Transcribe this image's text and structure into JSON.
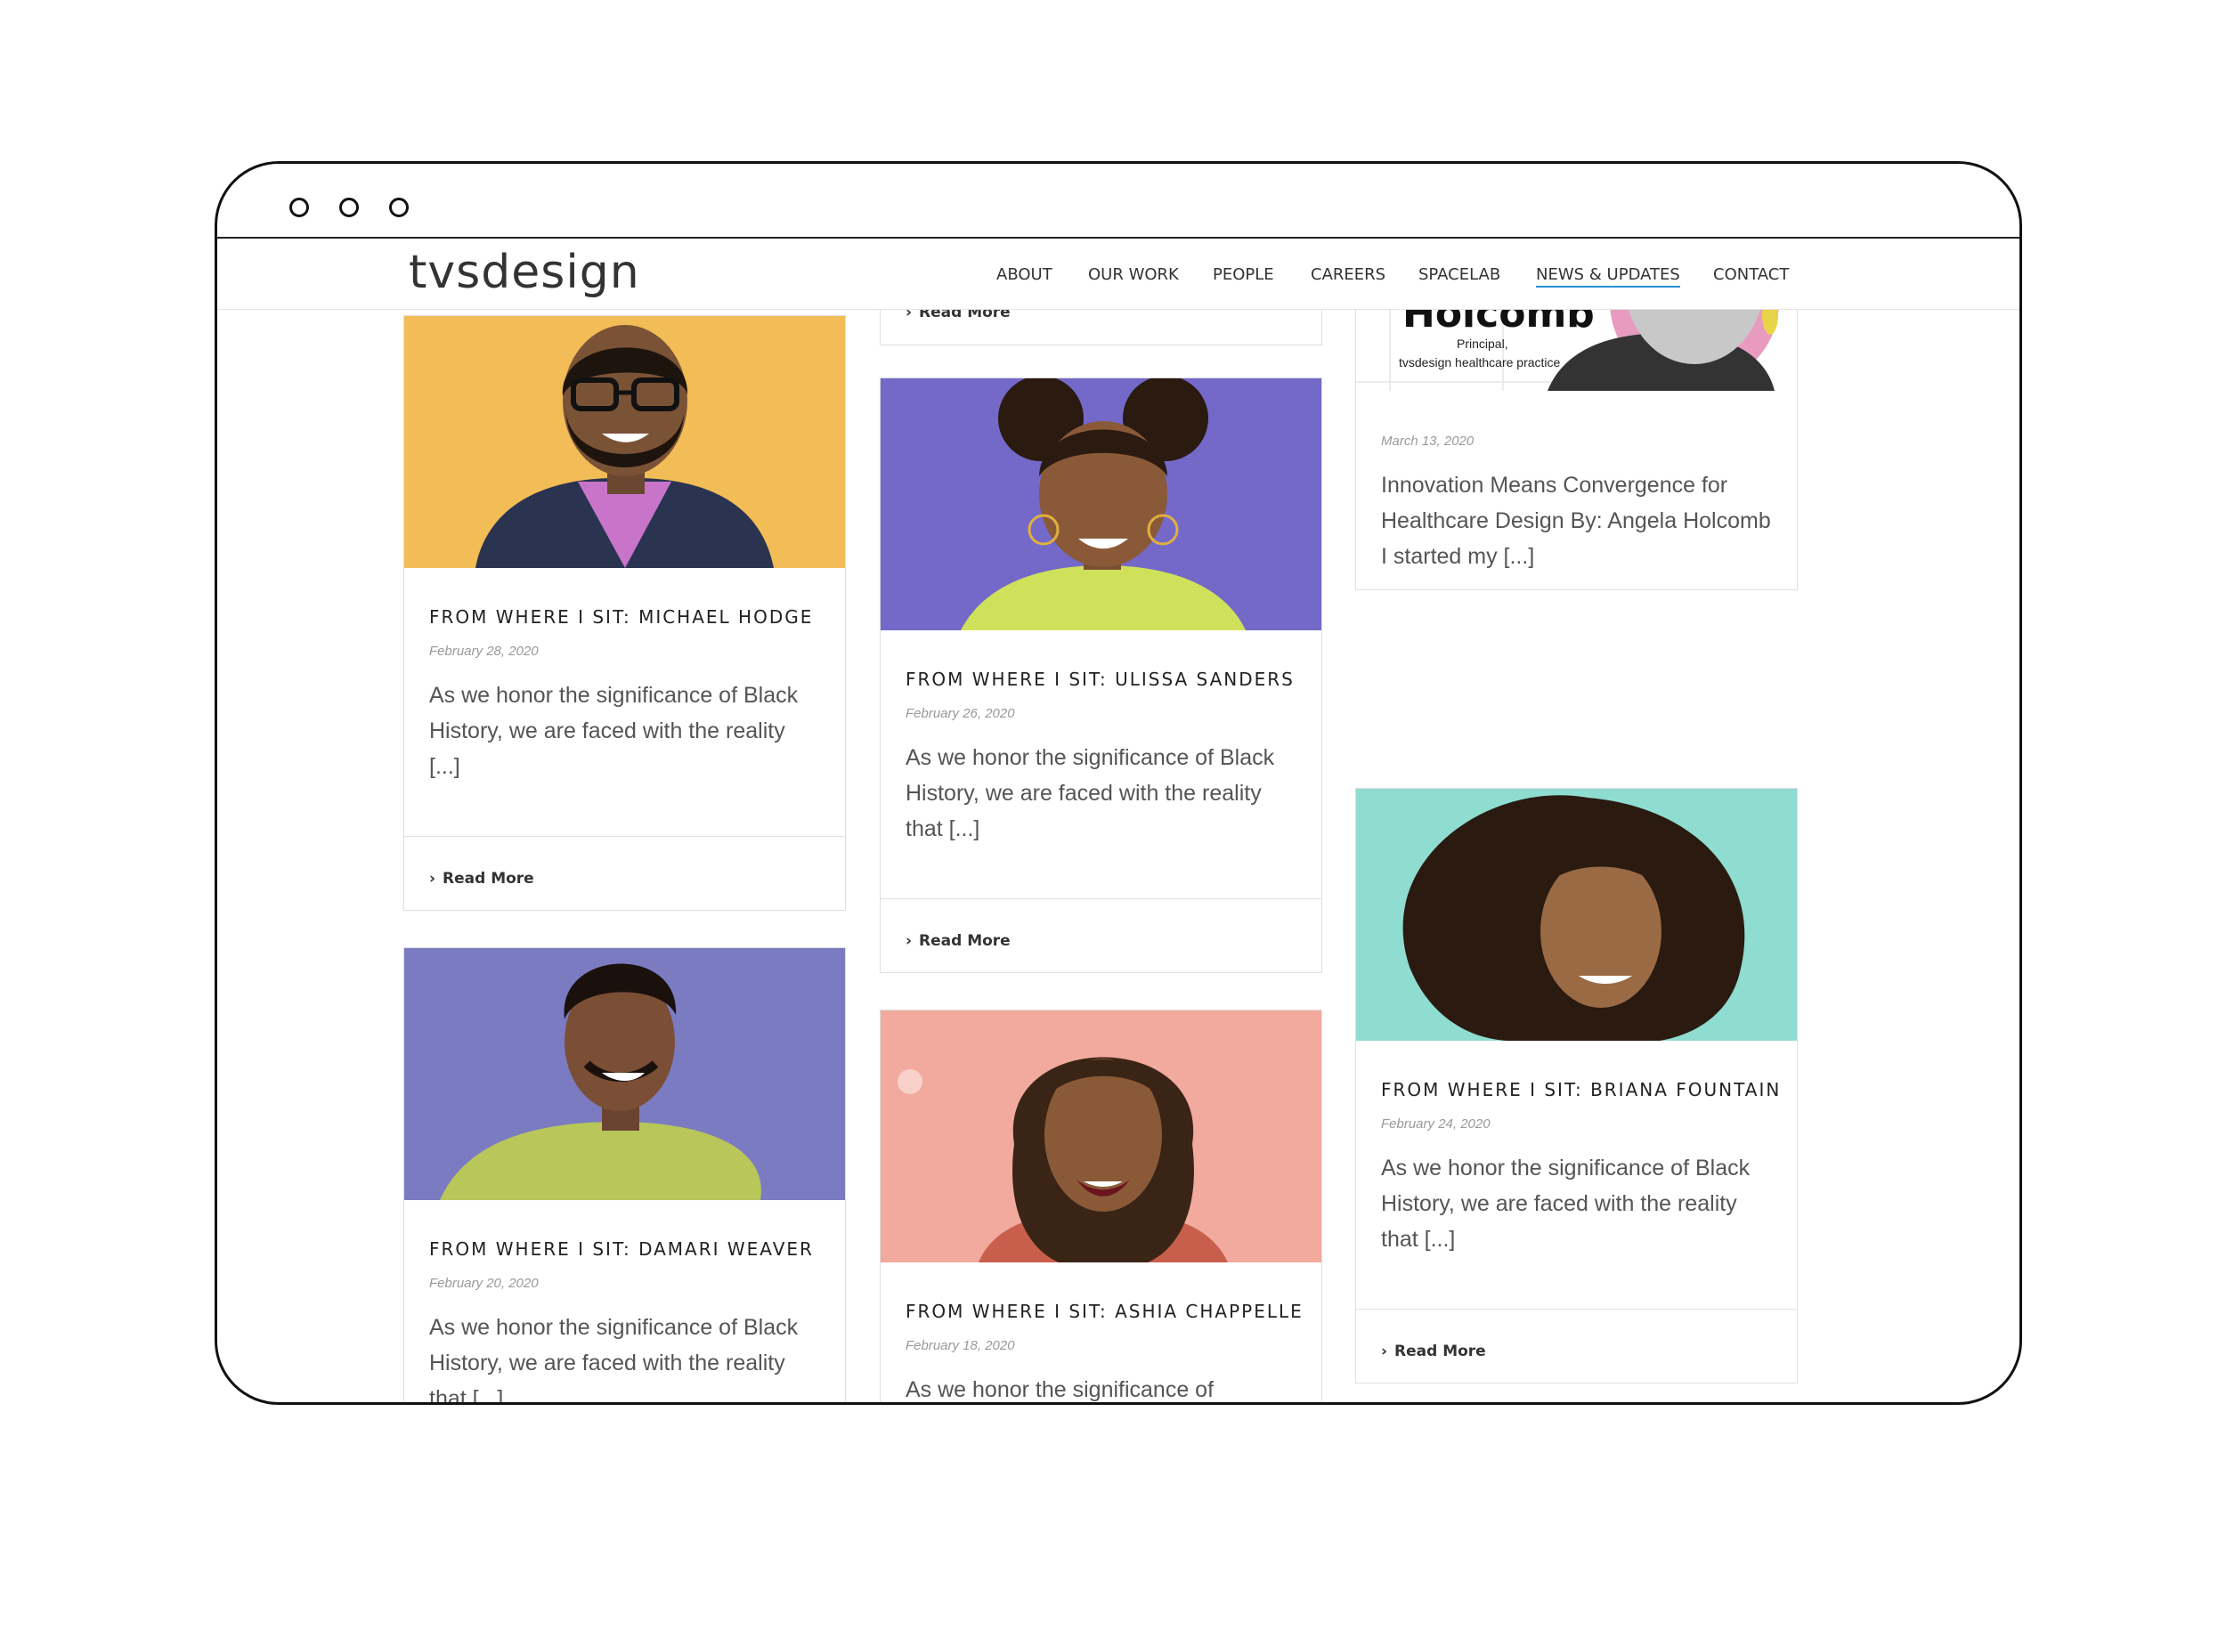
{
  "brand": {
    "logo": "tvsdesign"
  },
  "nav": {
    "items": [
      "ABOUT",
      "OUR WORK",
      "PEOPLE",
      "CAREERS",
      "SPACELAB",
      "NEWS & UPDATES",
      "CONTACT"
    ],
    "active": "NEWS & UPDATES"
  },
  "common": {
    "read_more": "Read More"
  },
  "cards": {
    "hodge": {
      "title": "FROM WHERE I SIT: MICHAEL HODGE",
      "date": "February 28, 2020",
      "excerpt": "  As we honor the significance of Black History, we are faced with the reality [...]",
      "bg": "#f2bc56"
    },
    "sanders": {
      "title": "FROM WHERE I SIT: ULISSA SANDERS",
      "date": "February 26, 2020",
      "excerpt": "As we honor the significance of Black History, we are faced with the reality that [...]",
      "bg": "#7469c9"
    },
    "holcomb": {
      "img_name": "Holcomb",
      "img_role_1": "Principal,",
      "img_role_2": "tvsdesign healthcare practice",
      "date": "March 13, 2020",
      "excerpt": "Innovation Means Convergence for Healthcare Design By: Angela Holcomb I started my [...]"
    },
    "fountain": {
      "title": "FROM WHERE I SIT: BRIANA FOUNTAIN",
      "date": "February 24, 2020",
      "excerpt": "As we honor the significance of Black History, we are faced with the reality that [...]",
      "bg": "#8fdcd0"
    },
    "weaver": {
      "title": "FROM WHERE I SIT: DAMARI WEAVER",
      "date": "February 20, 2020",
      "excerpt": "As we honor the significance of Black History, we are faced with the reality that [...]",
      "bg": "#7b7bc2"
    },
    "chappelle": {
      "title": "FROM WHERE I SIT: ASHIA CHAPPELLE",
      "date": "February 18, 2020",
      "excerpt": "  As we honor the significance of",
      "bg": "#f1aa9d"
    }
  }
}
